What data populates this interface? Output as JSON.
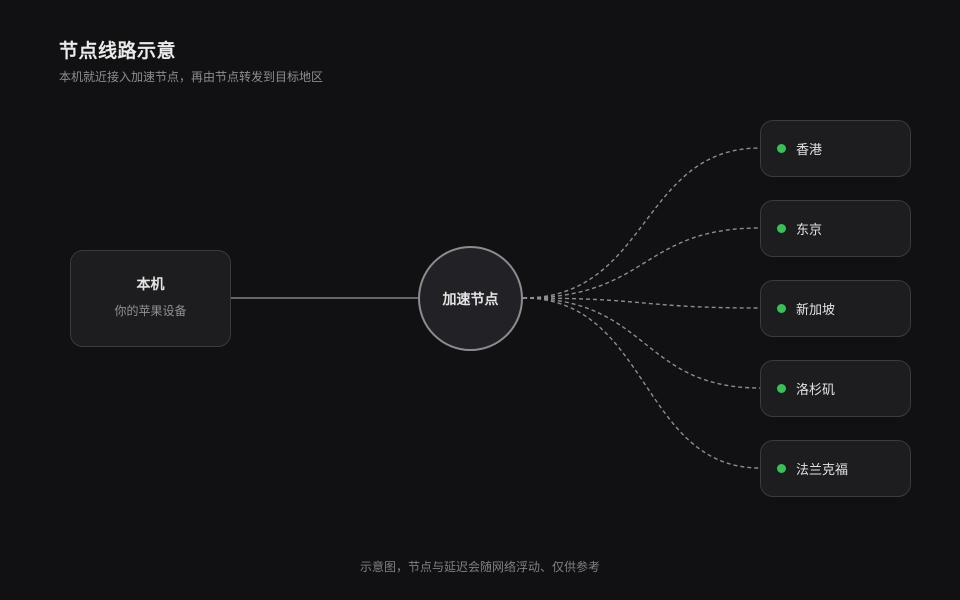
{
  "header": {
    "title": "节点线路示意",
    "subtitle": "本机就近接入加速节点，再由节点转发到目标地区"
  },
  "local": {
    "name": "本机",
    "description": "你的苹果设备"
  },
  "hub": {
    "label": "加速节点"
  },
  "destinations": [
    {
      "label": "香港",
      "status_color": "#33c553"
    },
    {
      "label": "东京",
      "status_color": "#33c553"
    },
    {
      "label": "新加坡",
      "status_color": "#33c553"
    },
    {
      "label": "洛杉矶",
      "status_color": "#33c553"
    },
    {
      "label": "法兰克福",
      "status_color": "#33c553"
    }
  ],
  "footer": {
    "note": "示意图，节点与延迟会随网络浮动、仅供参考"
  }
}
